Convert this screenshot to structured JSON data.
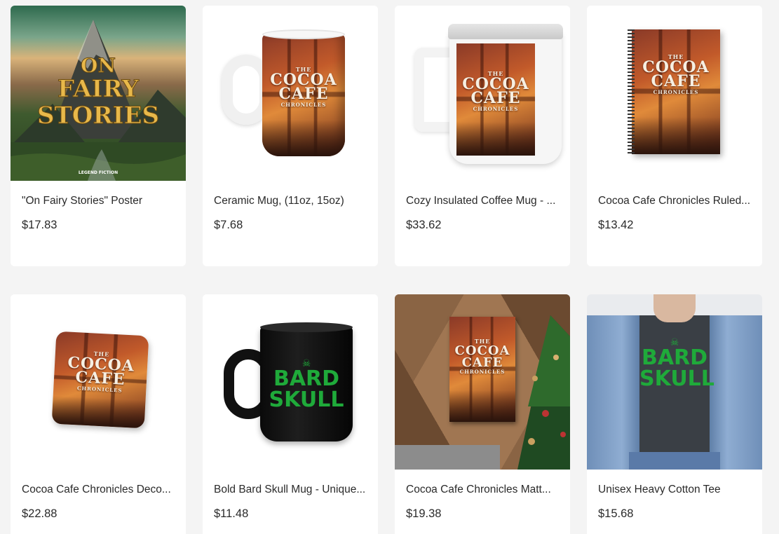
{
  "products": [
    {
      "title": "\"On Fairy Stories\" Poster",
      "price": "$17.83",
      "image_icon": "fairy-stories-poster-image",
      "art_text": [
        "ON",
        "FAIRY",
        "STORIES"
      ],
      "brand": "LEGEND FICTION"
    },
    {
      "title": "Ceramic Mug, (11oz, 15oz)",
      "price": "$7.68",
      "image_icon": "ceramic-mug-image",
      "art_text": [
        "THE",
        "COCOA",
        "CAFE",
        "CHRONICLES"
      ]
    },
    {
      "title": "Cozy Insulated Coffee Mug - ...",
      "price": "$33.62",
      "image_icon": "insulated-mug-image",
      "art_text": [
        "THE",
        "COCOA",
        "CAFE",
        "CHRONICLES"
      ]
    },
    {
      "title": "Cocoa Cafe Chronicles Ruled...",
      "price": "$13.42",
      "image_icon": "notebook-image",
      "art_text": [
        "THE",
        "COCOA",
        "CAFE",
        "CHRONICLES"
      ]
    },
    {
      "title": "Cocoa Cafe Chronicles Deco...",
      "price": "$22.88",
      "image_icon": "pillow-image",
      "art_text": [
        "THE",
        "COCOA",
        "CAFE",
        "CHRONICLES"
      ]
    },
    {
      "title": "Bold Bard Skull Mug - Unique...",
      "price": "$11.48",
      "image_icon": "skull-mug-image",
      "art_text": [
        "BARD",
        "SKULL"
      ]
    },
    {
      "title": "Cocoa Cafe Chronicles Matt...",
      "price": "$19.38",
      "image_icon": "matte-poster-image",
      "art_text": [
        "THE",
        "COCOA",
        "CAFE",
        "CHRONICLES"
      ]
    },
    {
      "title": "Unisex Heavy Cotton Tee",
      "price": "$15.68",
      "image_icon": "tshirt-image",
      "art_text": [
        "BARD",
        "SKULL"
      ]
    }
  ],
  "colors": {
    "page_bg": "#f4f4f4",
    "card_bg": "#ffffff",
    "skull_green": "#1faa3a",
    "gold": "#e8b84a"
  }
}
